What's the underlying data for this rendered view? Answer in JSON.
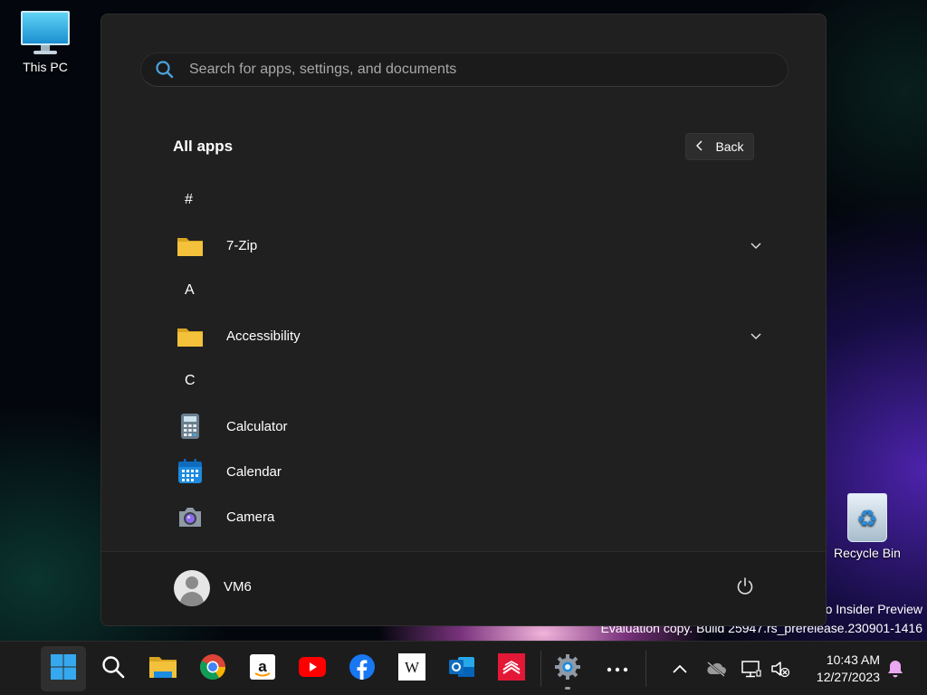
{
  "desktop": {
    "icons": [
      {
        "label": "This PC"
      },
      {
        "label": "Recycle Bin"
      }
    ],
    "watermark": {
      "line1": "o Insider Preview",
      "line2": "Evaluation copy. Build 25947.rs_prerelease.230901-1416"
    }
  },
  "start_menu": {
    "search": {
      "placeholder": "Search for apps, settings, and documents",
      "value": ""
    },
    "title": "All apps",
    "back_label": "Back",
    "sections": [
      {
        "letter": "#",
        "apps": [
          {
            "name": "7-Zip",
            "icon": "folder-icon",
            "expandable": true
          }
        ]
      },
      {
        "letter": "A",
        "apps": [
          {
            "name": "Accessibility",
            "icon": "folder-icon",
            "expandable": true
          }
        ]
      },
      {
        "letter": "C",
        "apps": [
          {
            "name": "Calculator",
            "icon": "calculator-icon",
            "expandable": false
          },
          {
            "name": "Calendar",
            "icon": "calendar-icon",
            "expandable": false
          },
          {
            "name": "Camera",
            "icon": "camera-icon",
            "expandable": false
          }
        ]
      }
    ],
    "user": {
      "name": "VM6"
    }
  },
  "taskbar": {
    "pinned": [
      "start-icon",
      "search-icon",
      "file-explorer-icon",
      "chrome-icon",
      "amazon-icon",
      "youtube-icon",
      "facebook-icon",
      "wikipedia-icon",
      "outlook-icon",
      "bank-of-america-icon",
      "settings-icon",
      "more-icon"
    ],
    "clock": {
      "time": "10:43 AM",
      "date": "12/27/2023"
    }
  },
  "colors": {
    "accent": "#4aa3e0",
    "folder": "#f3c13a",
    "menu_bg": "#202020",
    "taskbar_bg": "#1c1c1c"
  }
}
